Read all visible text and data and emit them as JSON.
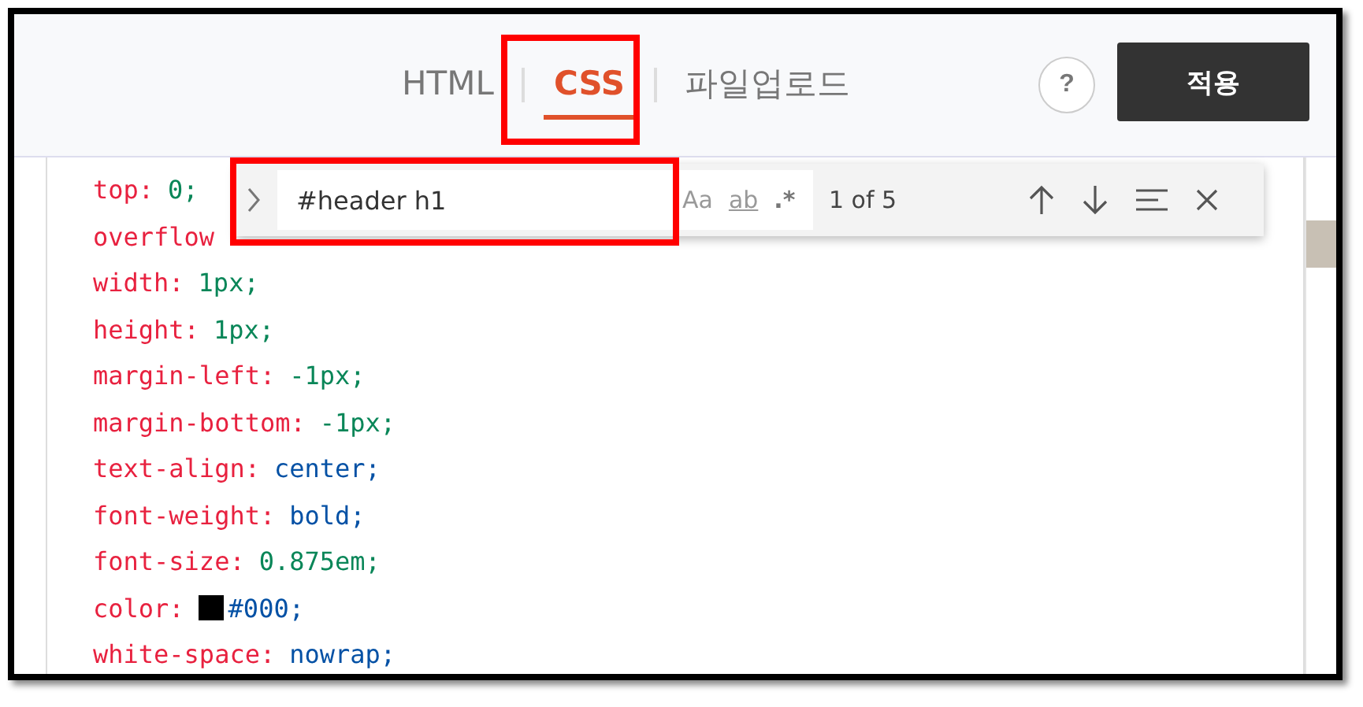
{
  "tabs": [
    {
      "label": "HTML",
      "selected": false
    },
    {
      "label": "CSS",
      "selected": true
    },
    {
      "label": "파일업로드",
      "selected": false
    }
  ],
  "help_button": {
    "label": "?"
  },
  "apply_button": {
    "label": "적용"
  },
  "code_lines": [
    {
      "property": "top:",
      "value": "0;",
      "kind": "number"
    },
    {
      "property": "overflow",
      "kind": "none"
    },
    {
      "property": "width:",
      "value": "1px;",
      "kind": "number"
    },
    {
      "property": "height:",
      "value": "1px;",
      "kind": "number"
    },
    {
      "property": "margin-left:",
      "value": "-1px;",
      "kind": "number"
    },
    {
      "property": "margin-bottom:",
      "value": "-1px;",
      "kind": "number"
    },
    {
      "property": "text-align:",
      "value": "center;",
      "kind": "keyword"
    },
    {
      "property": "font-weight:",
      "value": "bold;",
      "kind": "keyword"
    },
    {
      "property": "font-size:",
      "value": "0.875em;",
      "kind": "number"
    },
    {
      "property": "color:",
      "value": "#000;",
      "kind": "color",
      "color": "#000000"
    },
    {
      "property": "white-space:",
      "value": "nowrap;",
      "kind": "keyword"
    }
  ],
  "find_widget": {
    "value": "#header h1",
    "match_case": "Aa",
    "whole_word": "ab",
    "regex": ".*",
    "result": "1 of 5"
  }
}
